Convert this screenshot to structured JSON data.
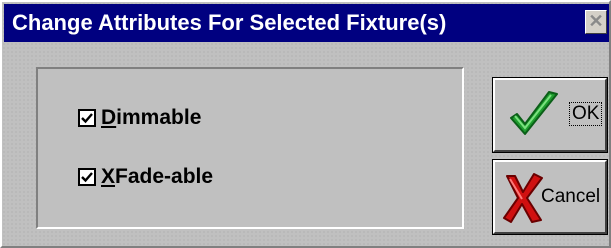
{
  "window": {
    "title": "Change Attributes For Selected Fixture(s)",
    "close_glyph": "✕"
  },
  "options": [
    {
      "mnemonic": "D",
      "rest": "immable",
      "checked": true
    },
    {
      "mnemonic": "X",
      "rest": "Fade-able",
      "checked": true
    }
  ],
  "buttons": {
    "ok_label": "OK",
    "ok_icon": "checkmark-icon",
    "cancel_label": "Cancel",
    "cancel_icon": "x-mark-icon"
  },
  "colors": {
    "titlebar": "#000080",
    "face": "#c0c0c0",
    "ok_icon": "#1e9e2e",
    "cancel_icon": "#d01010"
  }
}
